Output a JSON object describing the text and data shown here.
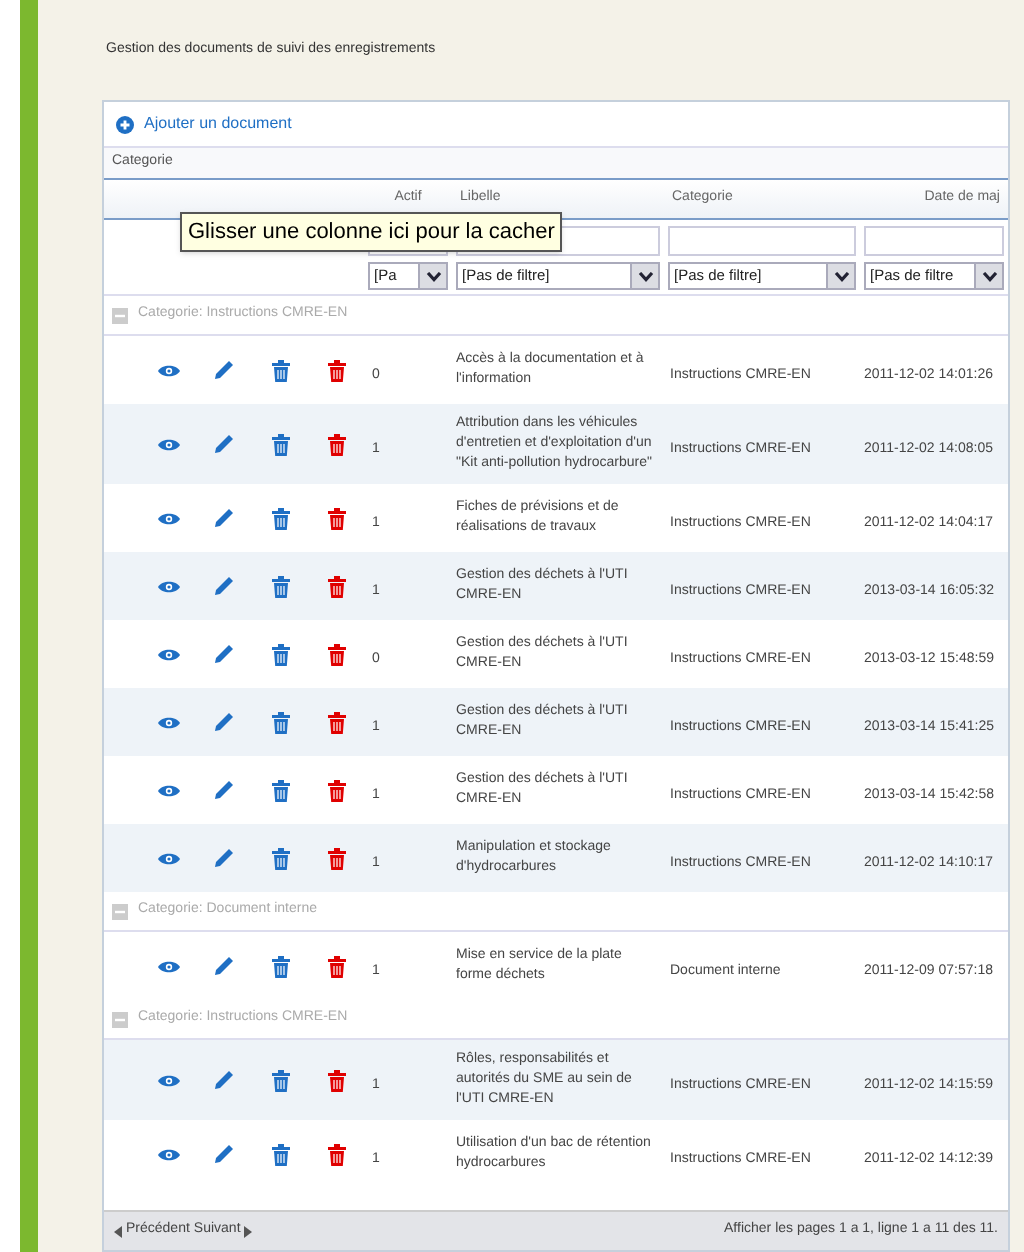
{
  "page_title": "Gestion des documents de suivi des enregistrements",
  "add_link": "Ajouter un document",
  "group_by": "Categorie",
  "columns": [
    "Actif",
    "Libelle",
    "Categorie",
    "Date de maj"
  ],
  "filters": [
    "[Pa",
    "[Pas de filtre]",
    "[Pas de filtre]",
    "[Pas de filtre"
  ],
  "tooltip": "Glisser une colonne ici pour la cacher",
  "groups": [
    {
      "label": "Categorie: Instructions CMRE-EN",
      "expanded": true,
      "rows": [
        {
          "actif": "0",
          "libelle": "Accès à la documentation et à l'information",
          "categorie": "Instructions CMRE-EN",
          "date": "2011-12-02 14:01:26"
        },
        {
          "actif": "1",
          "libelle": "Attribution dans les véhicules d'entretien et d'exploitation d'un \"Kit anti-pollution hydrocarbure\"",
          "categorie": "Instructions CMRE-EN",
          "date": "2011-12-02 14:08:05"
        },
        {
          "actif": "1",
          "libelle": "Fiches de prévisions et de réalisations de travaux",
          "categorie": "Instructions CMRE-EN",
          "date": "2011-12-02 14:04:17"
        },
        {
          "actif": "1",
          "libelle": "Gestion des déchets à l'UTI CMRE-EN",
          "categorie": "Instructions CMRE-EN",
          "date": "2013-03-14 16:05:32"
        },
        {
          "actif": "0",
          "libelle": "Gestion des déchets à l'UTI CMRE-EN",
          "categorie": "Instructions CMRE-EN",
          "date": "2013-03-12 15:48:59"
        },
        {
          "actif": "1",
          "libelle": "Gestion des déchets à l'UTI CMRE-EN",
          "categorie": "Instructions CMRE-EN",
          "date": "2013-03-14 15:41:25"
        },
        {
          "actif": "1",
          "libelle": "Gestion des déchets à l'UTI CMRE-EN",
          "categorie": "Instructions CMRE-EN",
          "date": "2013-03-14 15:42:58"
        },
        {
          "actif": "1",
          "libelle": "Manipulation et stockage d'hydrocarbures",
          "categorie": "Instructions CMRE-EN",
          "date": "2011-12-02 14:10:17"
        }
      ]
    },
    {
      "label": "Categorie: Document interne",
      "expanded": true,
      "rows": [
        {
          "actif": "1",
          "libelle": "Mise en service de la plate forme déchets",
          "categorie": "Document interne",
          "date": "2011-12-09 07:57:18"
        }
      ]
    },
    {
      "label": "Categorie: Instructions CMRE-EN",
      "expanded": true,
      "rows": [
        {
          "actif": "1",
          "libelle": "Rôles, responsabilités et autorités du SME au sein de l'UTI CMRE-EN",
          "categorie": "Instructions CMRE-EN",
          "date": "2011-12-02 14:15:59"
        },
        {
          "actif": "1",
          "libelle": "Utilisation d'un bac de rétention hydrocarbures",
          "categorie": "Instructions CMRE-EN",
          "date": "2011-12-02 14:12:39"
        }
      ]
    }
  ],
  "pager": {
    "previous": "Précédent",
    "next": "Suivant",
    "info": "Afficher les pages 1 a 1, ligne 1 a 11 des 11."
  }
}
